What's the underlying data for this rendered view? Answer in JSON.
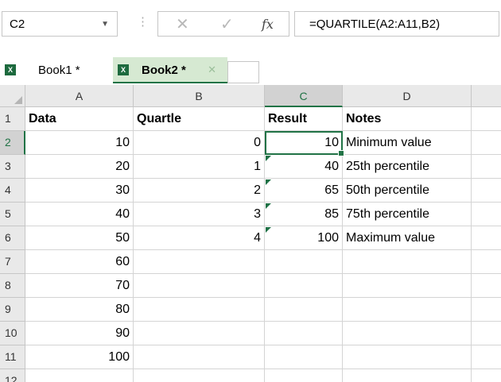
{
  "formula_bar": {
    "name_box": "C2",
    "cancel_glyph": "✕",
    "enter_glyph": "✓",
    "fx_label": "fx",
    "formula": "=QUARTILE(A2:A11,B2)"
  },
  "tabs": [
    {
      "label": "Book1 *",
      "active": false
    },
    {
      "label": "Book2 *",
      "active": true
    }
  ],
  "columns": [
    "A",
    "B",
    "C",
    "D"
  ],
  "rows": [
    {
      "num": "1",
      "a": "Data",
      "b": "Quartle",
      "c": "Result",
      "d": "Notes",
      "header": true
    },
    {
      "num": "2",
      "a": "10",
      "b": "0",
      "c": "10",
      "d": "Minimum value"
    },
    {
      "num": "3",
      "a": "20",
      "b": "1",
      "c": "40",
      "d": "25th percentile"
    },
    {
      "num": "4",
      "a": "30",
      "b": "2",
      "c": "65",
      "d": "50th percentile"
    },
    {
      "num": "5",
      "a": "40",
      "b": "3",
      "c": "85",
      "d": "75th percentile"
    },
    {
      "num": "6",
      "a": "50",
      "b": "4",
      "c": "100",
      "d": "Maximum value"
    },
    {
      "num": "7",
      "a": "60",
      "b": "",
      "c": "",
      "d": ""
    },
    {
      "num": "8",
      "a": "70",
      "b": "",
      "c": "",
      "d": ""
    },
    {
      "num": "9",
      "a": "80",
      "b": "",
      "c": "",
      "d": ""
    },
    {
      "num": "10",
      "a": "90",
      "b": "",
      "c": "",
      "d": ""
    },
    {
      "num": "11",
      "a": "100",
      "b": "",
      "c": "",
      "d": ""
    },
    {
      "num": "12",
      "a": "",
      "b": "",
      "c": "",
      "d": ""
    }
  ],
  "colors": {
    "accent": "#217346",
    "error_triangle": "#1e7145",
    "active_tab_bg": "#d6e9d2"
  }
}
